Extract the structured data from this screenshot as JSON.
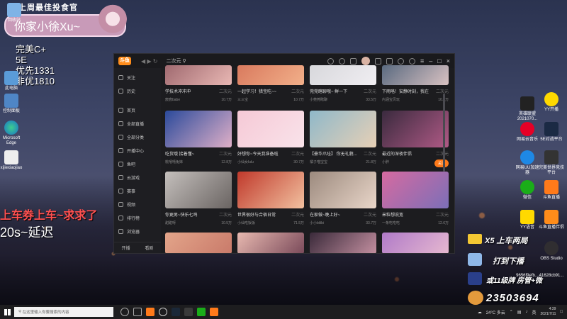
{
  "overlay": {
    "banner": "上周最佳投食官",
    "streamer_name": "你家小徐Xu~",
    "ranks": [
      "完美C+",
      "5E",
      "优先1331",
      "非优1810"
    ],
    "ticker": "上车券上车~求求了",
    "delay": "20s~延迟",
    "gift_line1": "X5  上车两局",
    "gift_line2": "打到下播",
    "gift_line3": "或11级牌  房管+微",
    "fan_id": "23503694"
  },
  "desktop_left": [
    {
      "label": "回收站"
    },
    {
      "label": "此电脑"
    },
    {
      "label": "控制面板"
    },
    {
      "label": "Microsoft Edge"
    },
    {
      "label": "xijiexiaojiao"
    }
  ],
  "desktop_right": [
    {
      "label": "英雄联盟 2021070..."
    },
    {
      "label": "YY开播"
    },
    {
      "label": "网易云音乐"
    },
    {
      "label": "5E对战平台"
    },
    {
      "label": "网易UU加速器"
    },
    {
      "label": "完美世界竞技平台"
    },
    {
      "label": "微信"
    },
    {
      "label": "斗鱼直播"
    },
    {
      "label": "YY语音"
    },
    {
      "label": "斗鱼直播伴侣"
    },
    {
      "label": "OBS Studio"
    },
    {
      "label": "9656f9efb..."
    },
    {
      "label": "41628cb91..."
    }
  ],
  "app": {
    "logo": "斗鱼",
    "search_text": "二次元",
    "colors": {
      "accent": "#ff7a1a",
      "bg": "#1c1c1f"
    },
    "sidebar": [
      {
        "label": "关注"
      },
      {
        "label": "历史"
      },
      {
        "label": "首页"
      },
      {
        "label": "全部直播"
      },
      {
        "label": "全部分类"
      },
      {
        "label": "开播中心"
      },
      {
        "label": "鱼吧"
      },
      {
        "label": "云游戏"
      },
      {
        "label": "赛事"
      },
      {
        "label": "视频"
      },
      {
        "label": "排行榜"
      },
      {
        "label": "浏览器"
      }
    ],
    "sidebar_bottom": [
      "开播",
      "看剧"
    ],
    "cards": [
      {
        "title": "学技术冲冲冲",
        "cat": "二次元",
        "user": "宸宸babe",
        "hot": "10.7万"
      },
      {
        "title": "一起学习！猎宝吃~~",
        "cat": "二次元",
        "user": "三三宝",
        "hot": "10.7万"
      },
      {
        "title": "莞莞瞎聊哦~ 鲜一下",
        "cat": "二次元",
        "user": "小莞莞瞎聊",
        "hot": "33.5万"
      },
      {
        "title": "下雨咯！安静时刻，我在",
        "cat": "二次元",
        "user": "内涵宝贝玩",
        "hot": "10.7万"
      },
      {
        "title": "吃货哦 接着懂~",
        "cat": "二次元",
        "user": "桃嘻嘻兔妹",
        "hot": "12.8万"
      },
      {
        "title": "好想你~今天我准备啦",
        "cat": "二次元",
        "user": "小仙女lulu",
        "hot": "30.7万"
      },
      {
        "title": "【豪华爪哇】 你无礼貌...",
        "cat": "二次元",
        "user": "橘子喵宝宝",
        "hot": "21.8万"
      },
      {
        "title": "最近的深夜伴侣",
        "cat": "二次元",
        "user": "小胖",
        "hot": "关注"
      },
      {
        "title": "你更男~快乐七鸡",
        "cat": "二次元",
        "user": "甜甜呀",
        "hot": "10.5万"
      },
      {
        "title": "世界很好与合宿日常",
        "cat": "二次元",
        "user": "小仙吃饭饭",
        "hot": "71.5万"
      },
      {
        "title": "在家做~晚上好~",
        "cat": "二次元",
        "user": "小小bilibi",
        "hot": "33.7万"
      },
      {
        "title": "米粒想说宽",
        "cat": "二次元",
        "user": "一条吃吃吃",
        "hot": "12.6万"
      }
    ]
  },
  "taskbar": {
    "search_placeholder": "在这里输入你要搜索的内容",
    "weather": "24°C 多云",
    "ime": "英",
    "time": "4:39",
    "date": "2021/7/11"
  }
}
